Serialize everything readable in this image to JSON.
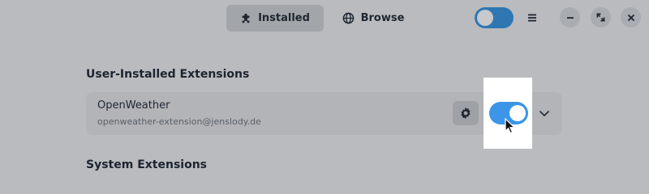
{
  "header": {
    "tabs": [
      {
        "label": "Installed",
        "icon": "puzzle-icon",
        "selected": true
      },
      {
        "label": "Browse",
        "icon": "globe-icon",
        "selected": false
      }
    ],
    "toggle_state": "off",
    "menu_icon": "hamburger-menu-icon",
    "window_controls": [
      "minimize-icon",
      "maximize-icon",
      "close-icon"
    ]
  },
  "sections": {
    "user_title": "User-Installed Extensions",
    "system_title": "System Extensions"
  },
  "extensions": [
    {
      "name": "OpenWeather",
      "id": "openweather-extension@jenslody.de",
      "enabled": true,
      "settings_icon": "gear-icon",
      "expand_icon": "chevron-down-icon"
    }
  ],
  "colors": {
    "background": "#b9bbbe",
    "toggle_on": "#3c95e6",
    "highlight": "#ffffff"
  }
}
